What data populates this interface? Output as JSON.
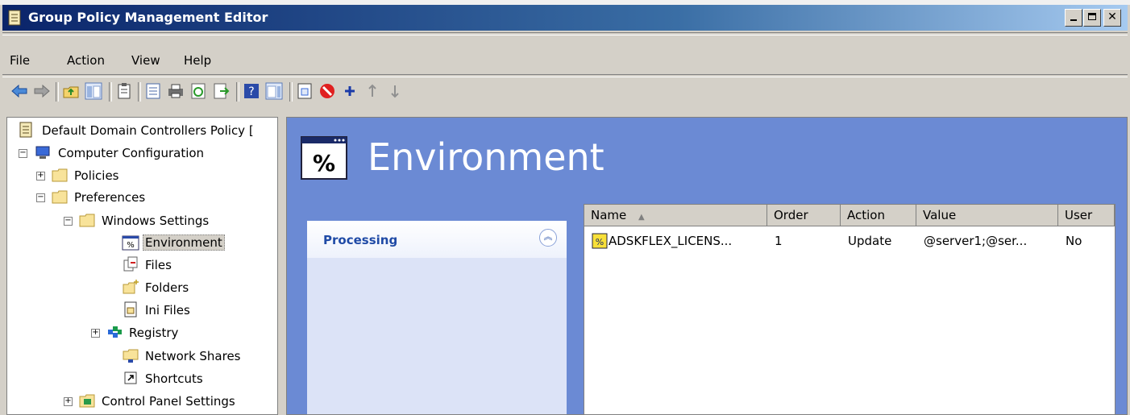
{
  "window": {
    "title": "Group Policy Management Editor"
  },
  "menu": [
    "File",
    "Action",
    "View",
    "Help"
  ],
  "tree": {
    "root": "Default Domain Controllers Policy [",
    "computer_configuration": "Computer Configuration",
    "policies": "Policies",
    "preferences": "Preferences",
    "windows_settings": "Windows Settings",
    "environment": "Environment",
    "files": "Files",
    "folders": "Folders",
    "ini_files": "Ini Files",
    "registry": "Registry",
    "network_shares": "Network Shares",
    "shortcuts": "Shortcuts",
    "control_panel_settings": "Control Panel Settings"
  },
  "main": {
    "heading": "Environment",
    "heading_icon_text": "%",
    "processing_label": "Processing",
    "columns": [
      "Name",
      "Order",
      "Action",
      "Value",
      "User"
    ],
    "rows": [
      {
        "name": "ADSKFLEX_LICENS...",
        "order": "1",
        "action": "Update",
        "value": "@server1;@ser...",
        "user": "No"
      }
    ]
  }
}
